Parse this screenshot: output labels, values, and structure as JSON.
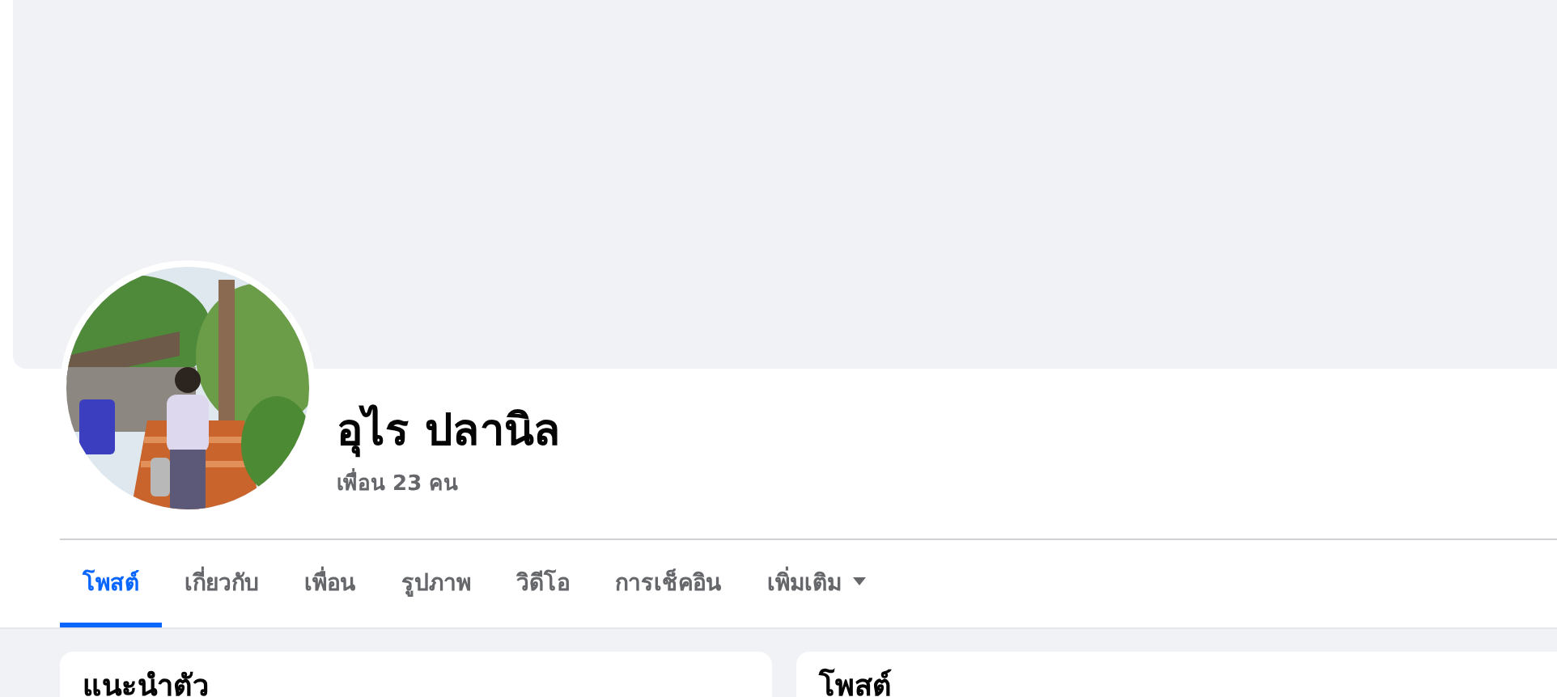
{
  "profile": {
    "name": "อุไร ปลานิล",
    "friends": "เพื่อน 23 คน"
  },
  "tabs": [
    {
      "label": "โพสต์",
      "selected": true,
      "dropdown": false
    },
    {
      "label": "เกี่ยวกับ",
      "selected": false,
      "dropdown": false
    },
    {
      "label": "เพื่อน",
      "selected": false,
      "dropdown": false
    },
    {
      "label": "รูปภาพ",
      "selected": false,
      "dropdown": false
    },
    {
      "label": "วิดีโอ",
      "selected": false,
      "dropdown": false
    },
    {
      "label": "การเช็คอิน",
      "selected": false,
      "dropdown": false
    },
    {
      "label": "เพิ่มเติม",
      "selected": false,
      "dropdown": true
    }
  ],
  "cards": [
    {
      "title": "แนะนำตัว"
    },
    {
      "title": "โพสต์"
    }
  ]
}
